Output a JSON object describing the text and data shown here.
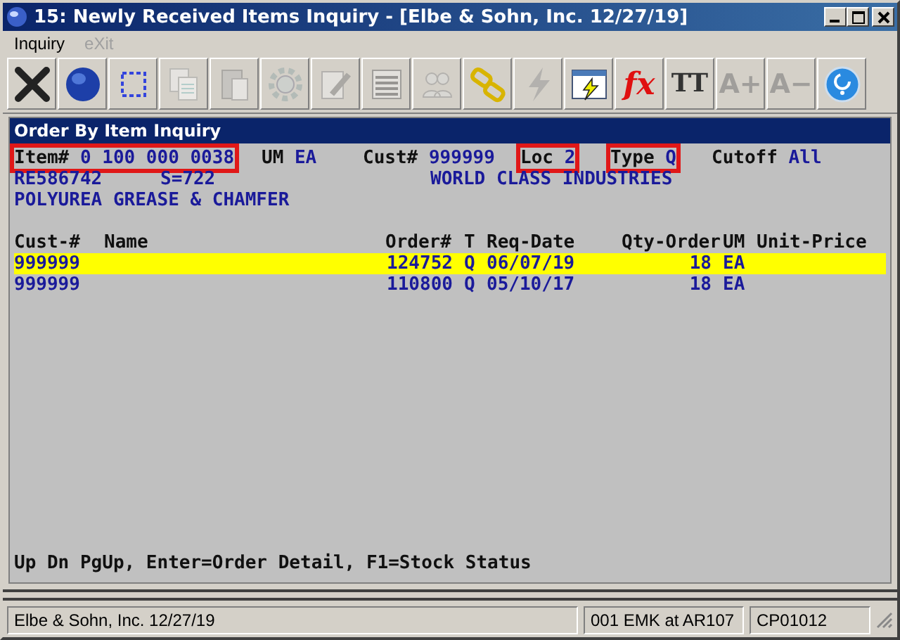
{
  "window": {
    "title": "15: Newly Received Items Inquiry - [Elbe & Sohn, Inc. 12/27/19]"
  },
  "menu": [
    {
      "label": "Inquiry",
      "disabled": false
    },
    {
      "label": "eXit",
      "disabled": true
    }
  ],
  "toolbar": [
    {
      "kind": "close",
      "disabled": false
    },
    {
      "kind": "globe",
      "disabled": false
    },
    {
      "kind": "select",
      "disabled": false
    },
    {
      "kind": "copy",
      "disabled": true
    },
    {
      "kind": "paste",
      "disabled": true
    },
    {
      "kind": "gear",
      "disabled": true
    },
    {
      "kind": "edit",
      "disabled": true
    },
    {
      "kind": "list",
      "disabled": true
    },
    {
      "kind": "people",
      "disabled": true
    },
    {
      "kind": "chain",
      "disabled": false
    },
    {
      "kind": "bolt",
      "disabled": true
    },
    {
      "kind": "window-bolt",
      "disabled": false
    },
    {
      "kind": "text",
      "glyph": "fx",
      "disabled": false
    },
    {
      "kind": "text",
      "glyph": "TT",
      "disabled": false
    },
    {
      "kind": "text",
      "glyph": "A+",
      "disabled": true
    },
    {
      "kind": "text",
      "glyph": "A−",
      "disabled": true
    },
    {
      "kind": "help",
      "disabled": false
    }
  ],
  "panel_title": "Order By Item Inquiry",
  "header_lines": [
    [
      {
        "label": "Item#",
        "value": "0 100 000 0038",
        "highlighted": true
      },
      {
        "label": "UM",
        "value": "EA",
        "highlighted": false
      },
      {
        "label": "Cust#",
        "value": "999999",
        "highlighted": false
      },
      {
        "label": "Loc",
        "value": "2",
        "highlighted": true
      },
      {
        "label": "Type",
        "value": "Q",
        "highlighted": true
      },
      {
        "label": "Cutoff",
        "value": "All",
        "highlighted": false
      }
    ],
    [
      {
        "value": "RE586742",
        "highlighted": false
      },
      {
        "value": "S=722",
        "highlighted": false
      },
      {
        "value": "WORLD CLASS INDUSTRIES",
        "highlighted": false
      }
    ],
    [
      {
        "value": "POLYUREA GREASE & CHAMFER",
        "highlighted": false
      }
    ]
  ],
  "table": {
    "columns": [
      "Cust-#",
      "Name",
      "Order#",
      "T",
      "Req-Date",
      "Qty-Order",
      "UM",
      "Unit-Price"
    ],
    "rows": [
      {
        "cust": "999999",
        "order": "124752",
        "t": "Q",
        "req_date": "06/07/19",
        "qty": "18",
        "um": "EA",
        "selected": true
      },
      {
        "cust": "999999",
        "order": "110800",
        "t": "Q",
        "req_date": "05/10/17",
        "qty": "18",
        "um": "EA",
        "selected": false
      }
    ]
  },
  "hint": "Up Dn PgUp, Enter=Order Detail, F1=Stock Status",
  "status_bar": [
    "Elbe & Sohn, Inc. 12/27/19",
    "001 EMK at AR107",
    "CP01012"
  ]
}
